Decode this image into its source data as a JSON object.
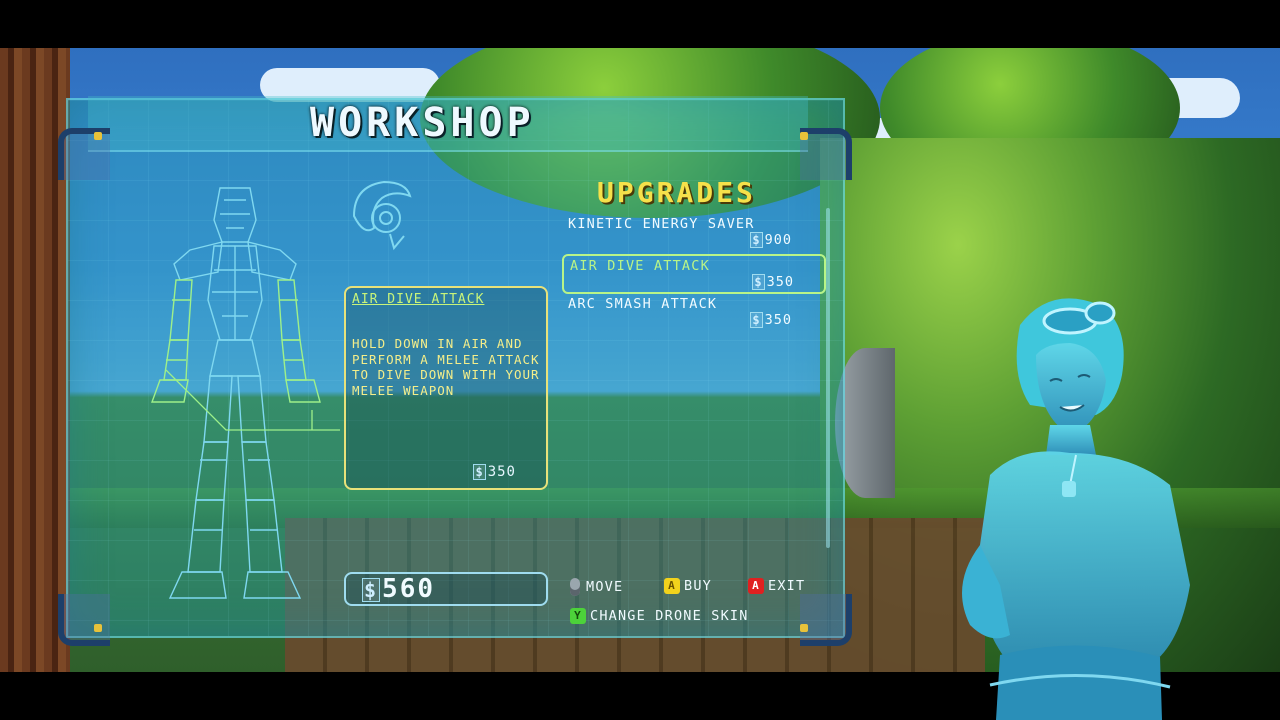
{
  "title": "WORKSHOP",
  "upgrades_heading": "UPGRADES",
  "currency_symbol": "$",
  "upgrades": [
    {
      "name": "KINETIC ENERGY SAVER",
      "price": "900",
      "selected": false
    },
    {
      "name": "AIR DIVE ATTACK",
      "price": "350",
      "selected": true
    },
    {
      "name": "ARC SMASH ATTACK",
      "price": "350",
      "selected": false
    }
  ],
  "detail": {
    "name": "AIR DIVE ATTACK",
    "description": "HOLD DOWN IN AIR AND PERFORM A MELEE ATTACK TO DIVE DOWN WITH YOUR MELEE WEAPON",
    "price": "350"
  },
  "money": "560",
  "controls": {
    "move": "MOVE",
    "buy_button": "A",
    "buy": "BUY",
    "exit_button": "A",
    "exit": "EXIT",
    "skin_button": "Y",
    "change_skin": "CHANGE DRONE SKIN"
  },
  "colors": {
    "panel": "#28aab9",
    "heading": "#f6e14a",
    "selected": "#b8f488",
    "description": "#f4ee8a",
    "blueprint": "#7fd8f0"
  }
}
